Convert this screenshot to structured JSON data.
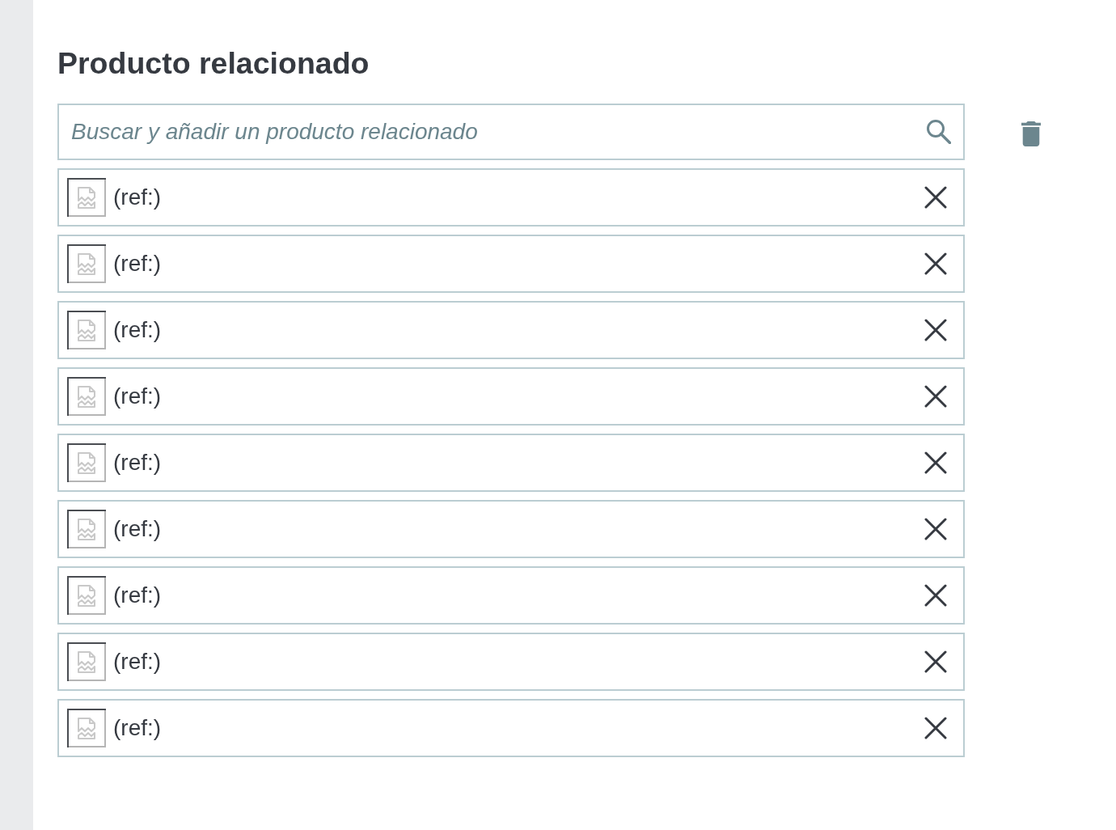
{
  "section": {
    "title": "Producto relacionado",
    "search": {
      "placeholder": "Buscar y añadir un producto relacionado"
    },
    "items": [
      {
        "reference": "(ref:)"
      },
      {
        "reference": "(ref:)"
      },
      {
        "reference": "(ref:)"
      },
      {
        "reference": "(ref:)"
      },
      {
        "reference": "(ref:)"
      },
      {
        "reference": "(ref:)"
      },
      {
        "reference": "(ref:)"
      },
      {
        "reference": "(ref:)"
      },
      {
        "reference": "(ref:)"
      }
    ]
  }
}
